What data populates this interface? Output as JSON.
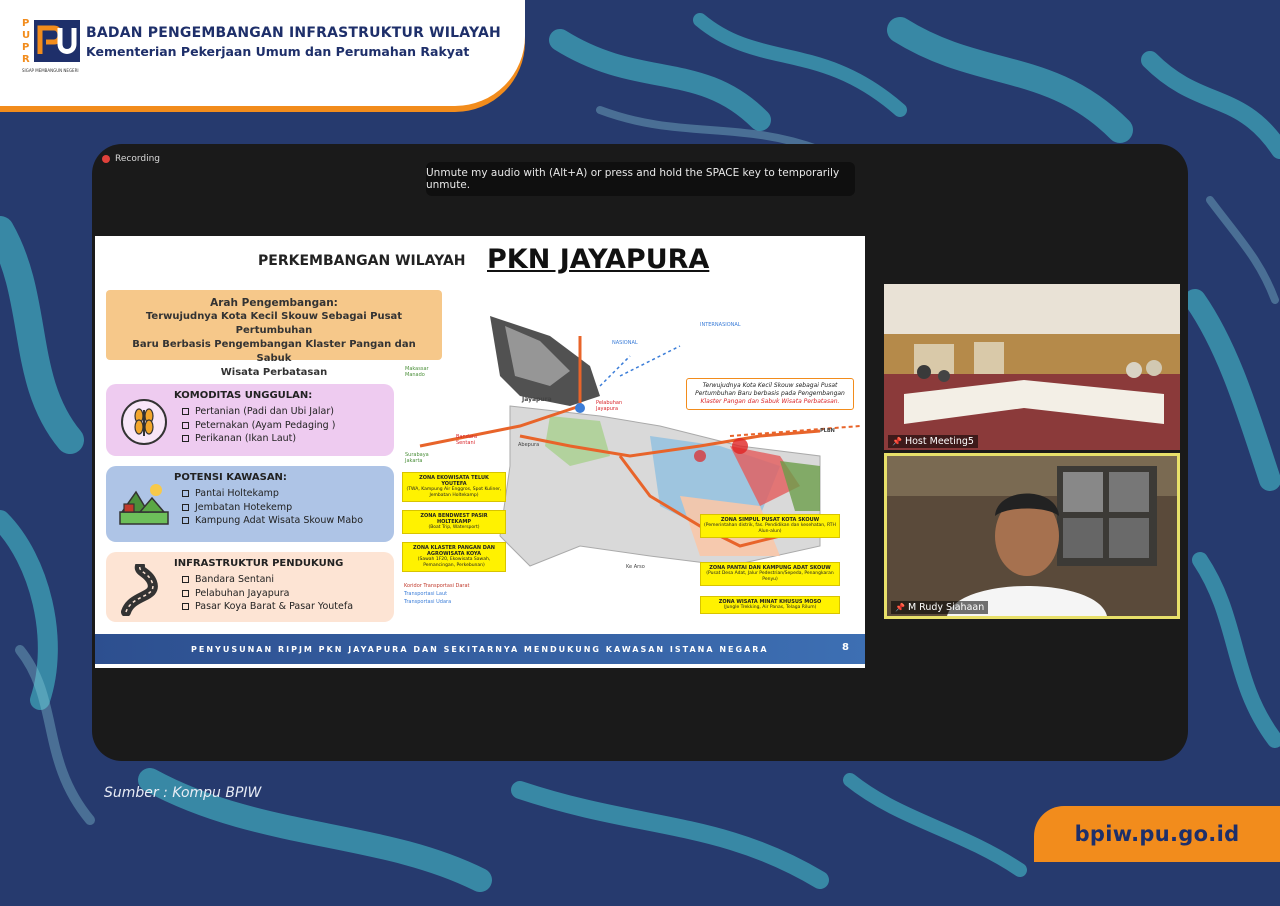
{
  "header": {
    "logo_letters": "PUPR",
    "logo_tagline": "SIGAP MEMBANGUN NEGERI",
    "org_name": "BADAN PENGEMBANGAN INFRASTRUKTUR WILAYAH",
    "ministry": "Kementerian Pekerjaan Umum dan Perumahan Rakyat"
  },
  "meeting": {
    "recording_label": "Recording",
    "unmute_tip": "Unmute my audio with (Alt+A) or press and hold the SPACE key to temporarily unmute."
  },
  "slide": {
    "title_prefix": "PERKEMBANGAN WILAYAH",
    "title_main": "PKN JAYAPURA",
    "arah": {
      "heading": "Arah Pengembangan:",
      "line1": "Terwujudnya Kota Kecil Skouw Sebagai Pusat Pertumbuhan",
      "line2": "Baru Berbasis Pengembangan Klaster Pangan dan Sabuk",
      "line3": "Wisata Perbatasan"
    },
    "komoditas": {
      "title": "KOMODITAS UNGGULAN:",
      "items": [
        "Pertanian (Padi dan Ubi Jalar)",
        "Peternakan (Ayam Pedaging )",
        "Perikanan (Ikan Laut)"
      ]
    },
    "potensi": {
      "title": "POTENSI KAWASAN:",
      "items": [
        "Pantai Holtekamp",
        "Jembatan Hotekemp",
        "Kampung Adat Wisata Skouw Mabo"
      ]
    },
    "infrastruktur": {
      "title": "INFRASTRUKTUR PENDUKUNG",
      "items": [
        "Bandara Sentani",
        "Pelabuhan Jayapura",
        "Pasar Koya Barat & Pasar Youtefa"
      ]
    },
    "map": {
      "labels": {
        "jayapura": "Jayapura",
        "abepura": "Abepura",
        "pelabuhan": "Pelabuhan Jayapura",
        "bandara": "Bandara Sentani",
        "nasional": "NASIONAL",
        "internasional": "INTERNASIONAL",
        "skouw": "PLBN",
        "ke_arso": "Ke Arso",
        "makassar": "Makassar Manado",
        "surabaya": "Surabaya Jakarta"
      },
      "target_text_1": "Terwujudnya Kota Kecil Skouw sebagai Pusat",
      "target_text_2": "Pertumbuhan Baru berbasis pada Pengembangan",
      "target_text_3": "Klaster Pangan dan Sabuk Wisata Perbatasan.",
      "zones": [
        {
          "title": "ZONA EKOWISATA TELUK YOUTEFA",
          "desc": "(TWA, Kampung Air Enggros, Spot Kuliner, Jembatan Holtekamp)"
        },
        {
          "title": "ZONA BENDWEST PASIR HOLTEKAMP",
          "desc": "(Boat Trip, Watersport)"
        },
        {
          "title": "ZONA KLASTER PANGAN DAN AGROWISATA KOYA",
          "desc": "(Sawah 1F20, Ekowisata Sawah, Pemancingan, Perkebunan)"
        },
        {
          "title": "ZONA SIMPUL PUSAT KOTA SKOUW",
          "desc": "(Pemerintahan distrik, fas. Pendidikan dan kesehatan, RTH Alun-alun)"
        },
        {
          "title": "ZONA PANTAI DAN KAMPUNG ADAT SKOUW",
          "desc": "(Pusat Desa Adat, Jalur Pedestrian/Sepeda, Penangkaran Penyu)"
        },
        {
          "title": "ZONA WISATA MINAT KHUSUS MOSO",
          "desc": "(Jungle Trekking, Air Panas, Telaga Rilum)"
        }
      ],
      "legend": [
        "Koridor Transportasi Darat",
        "Transportasi Laut",
        "Transportasi Udara"
      ]
    },
    "footer": "PENYUSUNAN RIPJM PKN JAYAPURA DAN SEKITARNYA MENDUKUNG KAWASAN ISTANA NEGARA",
    "page_number": "8"
  },
  "tiles": {
    "host_name": "Host Meeting5",
    "speaker_name": "M Rudy Siahaan"
  },
  "source": "Sumber : Kompu BPIW",
  "site": "bpiw.pu.go.id",
  "colors": {
    "background": "#263a6e",
    "brand_navy": "#1e2f6a",
    "brand_orange": "#f28c1c",
    "stroke_teal": "#3fa3b8"
  }
}
